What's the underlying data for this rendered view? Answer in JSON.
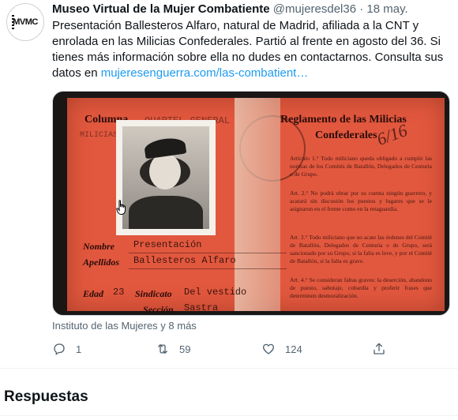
{
  "tweet": {
    "avatar_text": "MVMC",
    "author_name": "Museo Virtual de la Mujer Combatiente",
    "handle": "@mujeresdel36",
    "separator": "·",
    "date": "18 may.",
    "body_text": "Presentación Ballesteros Alfaro, natural de Madrid, afiliada a la CNT y enrolada en las Milicias Confederales. Partió al frente en agosto del 36. Si tienes más información sobre ella no dudes en contactarnos. Consulta sus datos en ",
    "link_text": "mujeresenguerra.com/las-combatient…",
    "media_attribution": "Instituto de las Mujeres y 8 más",
    "actions": {
      "reply_count": "1",
      "retweet_count": "59",
      "like_count": "124"
    }
  },
  "document_card": {
    "column_label": "Columna",
    "column_value": "QUARTEL GENERAL",
    "column_value2": "MILICIAS CONFEDERALES",
    "regulation_title": "Reglamento de las Milicias",
    "regulation_subtitle": "Confederales",
    "name_label": "Nombre",
    "name_value": "Presentación",
    "surname_label": "Apellidos",
    "surname_value": "Ballesteros Alfaro",
    "age_label": "Edad",
    "age_value": "23",
    "union_label": "Sindicato",
    "union_value": "Del vestido",
    "section_label": "Sección",
    "section_value": "Sastra",
    "handwritten_number": "6/16",
    "article_texts": [
      "Artículo 1.° Todo miliciano queda obligado a cumplir las normas de los Comités de Batallón, Delegados de Centuria o de Grupo.",
      "Art. 2.° No podrá obrar por su cuenta ningún guerrero, y acatará sin discusión los puestos y lugares que se le asignaron en el frente como en la retaguardia.",
      "Art. 3.° Todo miliciano que no acate las órdenes del Comité de Batallón, Delegados de Centuria o de Grupo, será sancionado por su Grupo, si la falta es leve, y por el Comité de Batallón, si la falta es grave.",
      "Art. 4.° Se consideran faltas graves: la deserción, abandono de puesto, sabotaje, cobardía y proferir frases que determinen desmoralización."
    ]
  },
  "replies": {
    "title": "Respuestas"
  },
  "colors": {
    "link": "#1d9bf0",
    "secondary_text": "#536471",
    "card_red": "#e2583e"
  },
  "icons": [
    "reply-icon",
    "retweet-icon",
    "like-icon",
    "share-icon",
    "hand-cursor-icon"
  ]
}
